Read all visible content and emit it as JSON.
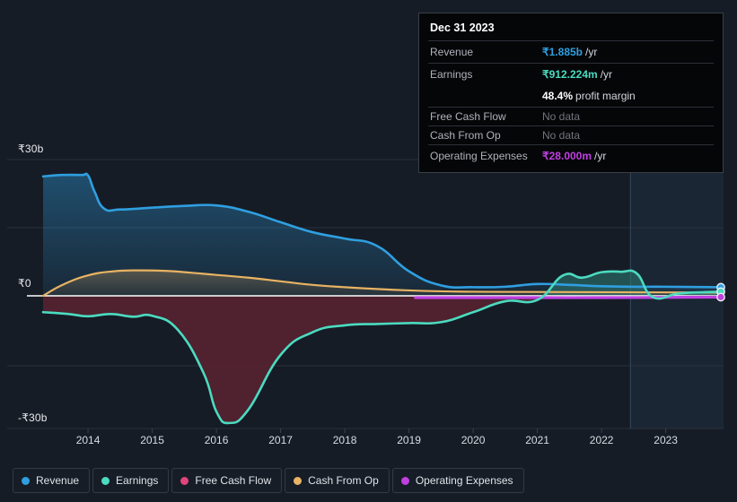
{
  "colors": {
    "background": "#161c26",
    "revenue": "#2f9fe0",
    "earnings": "#4bdbc0",
    "free_cash_flow": "#e0457b",
    "cash_from_op": "#e8b363",
    "operating_expenses": "#c040e0",
    "zero_line": "#ffffff",
    "grid": "#2b313b",
    "tooltip_bg": "#050608",
    "tooltip_border": "#3a3f47"
  },
  "tooltip": {
    "title": "Dec 31 2023",
    "rows": [
      {
        "key": "Revenue",
        "value": "₹1.885b",
        "suffix": "/yr",
        "color": "#2f9fe0",
        "nodata": false
      },
      {
        "key": "Earnings",
        "value": "₹912.224m",
        "suffix": "/yr",
        "color": "#4bdbc0",
        "nodata": false
      },
      {
        "key": "Free Cash Flow",
        "value": "No data",
        "suffix": "",
        "color": "#70757c",
        "nodata": true
      },
      {
        "key": "Cash From Op",
        "value": "No data",
        "suffix": "",
        "color": "#70757c",
        "nodata": true
      },
      {
        "key": "Operating Expenses",
        "value": "₹28.000m",
        "suffix": "/yr",
        "color": "#c040e0",
        "nodata": false
      }
    ],
    "margin_value": "48.4%",
    "margin_label": "profit margin"
  },
  "legend": {
    "items": [
      {
        "label": "Revenue",
        "color": "#2f9fe0"
      },
      {
        "label": "Earnings",
        "color": "#4bdbc0"
      },
      {
        "label": "Free Cash Flow",
        "color": "#e0457b"
      },
      {
        "label": "Cash From Op",
        "color": "#e8b363"
      },
      {
        "label": "Operating Expenses",
        "color": "#c040e0"
      }
    ]
  },
  "chart_data": {
    "type": "area",
    "title": "",
    "xlabel": "",
    "ylabel": "",
    "ylim": [
      -30,
      30
    ],
    "ytick_labels": [
      "₹30b",
      "₹0",
      "-₹30b"
    ],
    "ytick_values": [
      30,
      0,
      -30
    ],
    "xtick_labels": [
      "2014",
      "2015",
      "2016",
      "2017",
      "2018",
      "2019",
      "2020",
      "2021",
      "2022",
      "2023"
    ],
    "xlim": [
      2013.3,
      2023.9
    ],
    "grid": true,
    "legend_position": "bottom",
    "units": "INR (billions)",
    "highlight_band": {
      "from": 2022.45,
      "to": 2023.9
    },
    "series": [
      {
        "name": "Revenue",
        "color": "#2f9fe0",
        "x": [
          2013.3,
          2013.6,
          2013.9,
          2014.0,
          2014.1,
          2014.25,
          2014.5,
          2015.0,
          2015.5,
          2016.0,
          2016.5,
          2017.0,
          2017.5,
          2018.0,
          2018.5,
          2019.0,
          2019.5,
          2020.0,
          2020.5,
          2021.0,
          2021.5,
          2022.0,
          2022.5,
          2023.0,
          2023.9
        ],
        "values": [
          26.3,
          26.6,
          26.6,
          26.5,
          23.0,
          19.2,
          19.0,
          19.4,
          19.8,
          19.9,
          18.5,
          16.2,
          14.0,
          12.6,
          11.0,
          5.4,
          2.3,
          1.9,
          2.0,
          2.6,
          2.4,
          2.1,
          2.0,
          2.0,
          1.885
        ]
      },
      {
        "name": "Earnings",
        "color": "#4bdbc0",
        "x": [
          2013.3,
          2013.7,
          2014.0,
          2014.35,
          2014.7,
          2015.0,
          2015.4,
          2015.8,
          2016.0,
          2016.2,
          2016.5,
          2017.0,
          2017.5,
          2018.0,
          2018.5,
          2019.0,
          2019.5,
          2020.0,
          2020.5,
          2021.0,
          2021.4,
          2021.7,
          2022.0,
          2022.3,
          2022.55,
          2022.8,
          2023.2,
          2023.6,
          2023.9
        ],
        "values": [
          -3.6,
          -4.0,
          -4.5,
          -4.0,
          -4.6,
          -4.4,
          -7.5,
          -17.0,
          -25.5,
          -28.0,
          -25.0,
          -13.0,
          -8.0,
          -6.5,
          -6.2,
          -6.0,
          -5.8,
          -3.6,
          -1.2,
          -0.9,
          4.5,
          4.0,
          5.2,
          5.3,
          4.9,
          -0.3,
          0.5,
          0.8,
          0.912
        ]
      },
      {
        "name": "Free Cash Flow",
        "color": "#e0457b",
        "x": [
          2013.3,
          2023.9
        ],
        "values": [
          null,
          null
        ]
      },
      {
        "name": "Cash From Op",
        "color": "#e8b363",
        "x": [
          2013.3,
          2013.6,
          2014.0,
          2014.4,
          2014.8,
          2015.2,
          2015.6,
          2016.0,
          2016.5,
          2017.0,
          2017.5,
          2018.0,
          2018.5,
          2019.0,
          2019.5,
          2020.0,
          2021.0,
          2022.0,
          2023.0,
          2023.9
        ],
        "values": [
          0.0,
          2.4,
          4.5,
          5.4,
          5.6,
          5.5,
          5.1,
          4.6,
          4.0,
          3.2,
          2.4,
          1.9,
          1.5,
          1.2,
          1.0,
          0.9,
          0.85,
          0.8,
          0.75,
          0.7
        ]
      },
      {
        "name": "Operating Expenses",
        "color": "#c040e0",
        "x": [
          2019.1,
          2020.0,
          2021.0,
          2022.0,
          2023.0,
          2023.9
        ],
        "values": [
          -0.4,
          -0.4,
          -0.4,
          -0.4,
          -0.35,
          -0.28
        ]
      }
    ]
  }
}
